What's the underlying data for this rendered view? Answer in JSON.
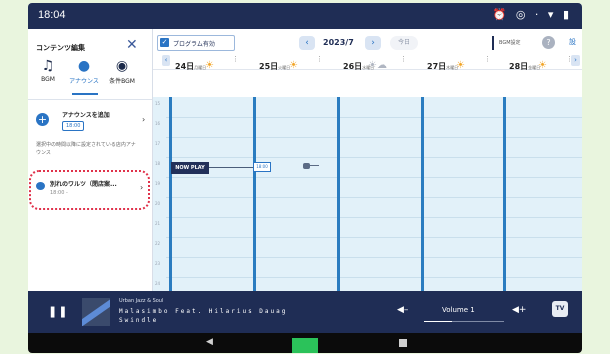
{
  "status_bar": {
    "time": "18:04",
    "icons": "⏰ ◎ · ▾ ▮"
  },
  "left_panel": {
    "title": "コンテンツ編集",
    "close": "✕",
    "modes": [
      {
        "label": "BGM",
        "icon": "♫"
      },
      {
        "label": "アナウンス",
        "icon": "●"
      },
      {
        "label": "条件BGM",
        "icon": "◉"
      }
    ],
    "add_announcement": {
      "plus": "+",
      "label": "アナウンスを追加",
      "time": "18:00",
      "chevron": "›"
    },
    "description": "選択中の時間以降に設定されている店内アナウンス",
    "announcement_item": {
      "title": "別れのワルツ（閉店案...",
      "subtitle": "18:00 -",
      "chevron": "›"
    },
    "accent_color": "#2a74c4",
    "highlight_color": "#e0324b"
  },
  "toolbar": {
    "program_label": "プログラム有効",
    "program_checked": "✓",
    "prev": "‹",
    "month": "2023/7",
    "next": "›",
    "today": "今日",
    "settings_label": "BGM設定",
    "help": "?",
    "more": "設"
  },
  "days": [
    {
      "label": "24日",
      "weekday": "月曜日",
      "weather": "☀"
    },
    {
      "label": "25日",
      "weekday": "火曜日",
      "weather": "☀"
    },
    {
      "label": "26日",
      "weekday": "水曜日",
      "weather": "☀☁"
    },
    {
      "label": "27日",
      "weekday": "木曜日",
      "weather": "☀"
    },
    {
      "label": "28日",
      "weekday": "金曜日",
      "weather": "☀"
    }
  ],
  "grid": {
    "hours": [
      "15",
      "16",
      "17",
      "18",
      "19",
      "20",
      "21",
      "22",
      "23",
      "24"
    ],
    "now_play": "NOW PLAY",
    "now_time": "18:00"
  },
  "player": {
    "pause": "❚❚",
    "genre": "Urban Jazz & Soul",
    "track": "Malasimbo Feat. Hilarius Dauag Swindle",
    "vol_down": "◀–",
    "volume_label": "Volume 1",
    "volume_level": 0.35,
    "vol_up": "◀+",
    "tv": "TV"
  },
  "nav_bar": {
    "back": "◀"
  }
}
